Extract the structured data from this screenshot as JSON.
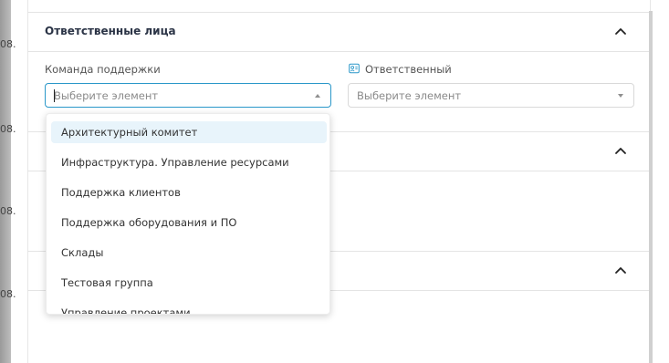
{
  "background_fragments": [
    "08.",
    "08.",
    "08.",
    "08."
  ],
  "section": {
    "title": "Ответственные лица"
  },
  "fields": {
    "support_team": {
      "label": "Команда поддержки",
      "placeholder": "Выберите элемент"
    },
    "responsible": {
      "label": "Ответственный",
      "placeholder": "Выберите элемент"
    }
  },
  "dropdown": {
    "options": [
      "Архитектурный комитет",
      "Инфраструктура. Управление ресурсами",
      "Поддержка клиентов",
      "Поддержка оборудования и ПО",
      "Склады",
      "Тестовая группа",
      "Управление проектами"
    ],
    "highlighted_index": 0
  },
  "colors": {
    "accent": "#2a97c9",
    "highlight": "#e8f4fb",
    "title": "#2b3446"
  },
  "icons": {
    "collapse": "chevron-up-icon",
    "person": "user-card-icon"
  }
}
